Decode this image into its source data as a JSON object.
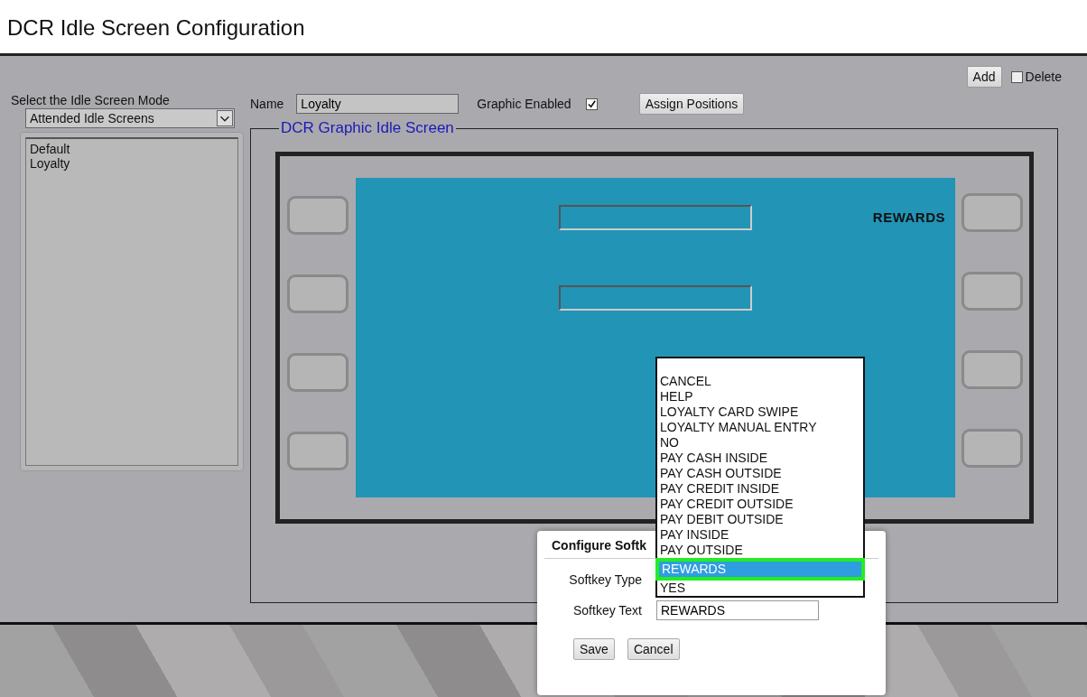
{
  "page": {
    "title": "DCR Idle Screen Configuration"
  },
  "toolbar": {
    "add_button": "Add",
    "delete": {
      "label": "Delete",
      "checked": false
    }
  },
  "mode": {
    "label": "Select the Idle Screen Mode",
    "value": "Attended Idle Screens"
  },
  "screens": [
    {
      "name": "Default",
      "selected": false
    },
    {
      "name": "Loyalty",
      "selected": false
    }
  ],
  "form": {
    "name_label": "Name",
    "name_value": "Loyalty",
    "graphic_label": "Graphic Enabled",
    "graphic_enabled": true,
    "assign_button": "Assign Positions"
  },
  "idle_screen": {
    "legend": "DCR Graphic Idle Screen",
    "softkey_label": "REWARDS"
  },
  "dialog": {
    "title": "Configure Softk",
    "type_label": "Softkey Type",
    "text_label": "Softkey Text",
    "text_value": "REWARDS",
    "buttons": [
      "Save",
      "Cancel"
    ]
  },
  "softkey_type_list": [
    {
      "label": "CANCEL",
      "selected": false,
      "marked": false
    },
    {
      "label": "HELP",
      "selected": false,
      "marked": false
    },
    {
      "label": "LOYALTY CARD SWIPE",
      "selected": false,
      "marked": false
    },
    {
      "label": "LOYALTY MANUAL ENTRY",
      "selected": false,
      "marked": false
    },
    {
      "label": "NO",
      "selected": false,
      "marked": false
    },
    {
      "label": "PAY CASH INSIDE",
      "selected": false,
      "marked": false
    },
    {
      "label": "PAY CASH OUTSIDE",
      "selected": false,
      "marked": false
    },
    {
      "label": "PAY CREDIT INSIDE",
      "selected": false,
      "marked": false
    },
    {
      "label": "PAY CREDIT OUTSIDE",
      "selected": false,
      "marked": false
    },
    {
      "label": "PAY DEBIT OUTSIDE",
      "selected": false,
      "marked": false
    },
    {
      "label": "PAY INSIDE",
      "selected": false,
      "marked": false
    },
    {
      "label": "PAY OUTSIDE",
      "selected": false,
      "marked": false
    },
    {
      "label": "REWARDS",
      "selected": true,
      "marked": true
    },
    {
      "label": "YES",
      "selected": false,
      "marked": false
    }
  ]
}
